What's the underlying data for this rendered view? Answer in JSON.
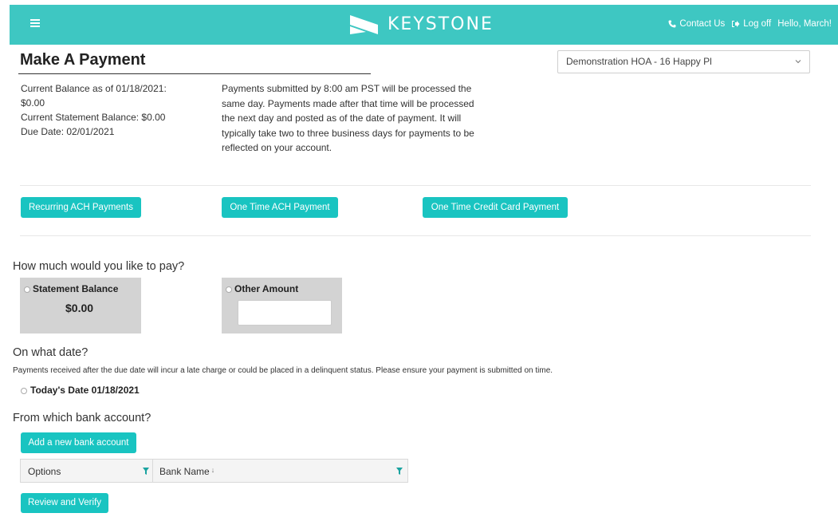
{
  "header": {
    "brand": "KEYSTONE",
    "contact": "Contact Us",
    "logoff": "Log off",
    "greeting": "Hello, March!"
  },
  "page": {
    "title": "Make A Payment",
    "association_select": "Demonstration HOA - 16 Happy Pl"
  },
  "balances": {
    "current_label": "Current Balance as of 01/18/2021:",
    "current_value": "$0.00",
    "statement": "Current Statement Balance: $0.00",
    "due": "Due Date: 02/01/2021"
  },
  "notice": "Payments submitted by 8:00 am PST will be processed the same day. Payments made after that time will be processed the next day and posted as of the date of payment. It will typically take two to three business days for payments to be reflected on your account.",
  "payment_types": {
    "recurring_ach": "Recurring ACH Payments",
    "one_time_ach": "One Time ACH Payment",
    "one_time_card": "One Time Credit Card Payment"
  },
  "amount": {
    "heading": "How much would you like to pay?",
    "statement_label": "Statement Balance",
    "statement_value": "$0.00",
    "other_label": "Other Amount"
  },
  "date": {
    "heading": "On what date?",
    "note": "Payments received after the due date will incur a late charge or could be placed in a delinquent status. Please ensure your payment is submitted on time.",
    "today": "Today's Date 01/18/2021"
  },
  "bank": {
    "heading": "From which bank account?",
    "add_button": "Add a new bank account",
    "columns": [
      "Options",
      "Bank Name"
    ],
    "review_button": "Review and Verify"
  },
  "colors": {
    "header_bg": "#3ec7c2",
    "button_bg": "#19c4c1",
    "amount_box_bg": "#d3d3d3"
  }
}
